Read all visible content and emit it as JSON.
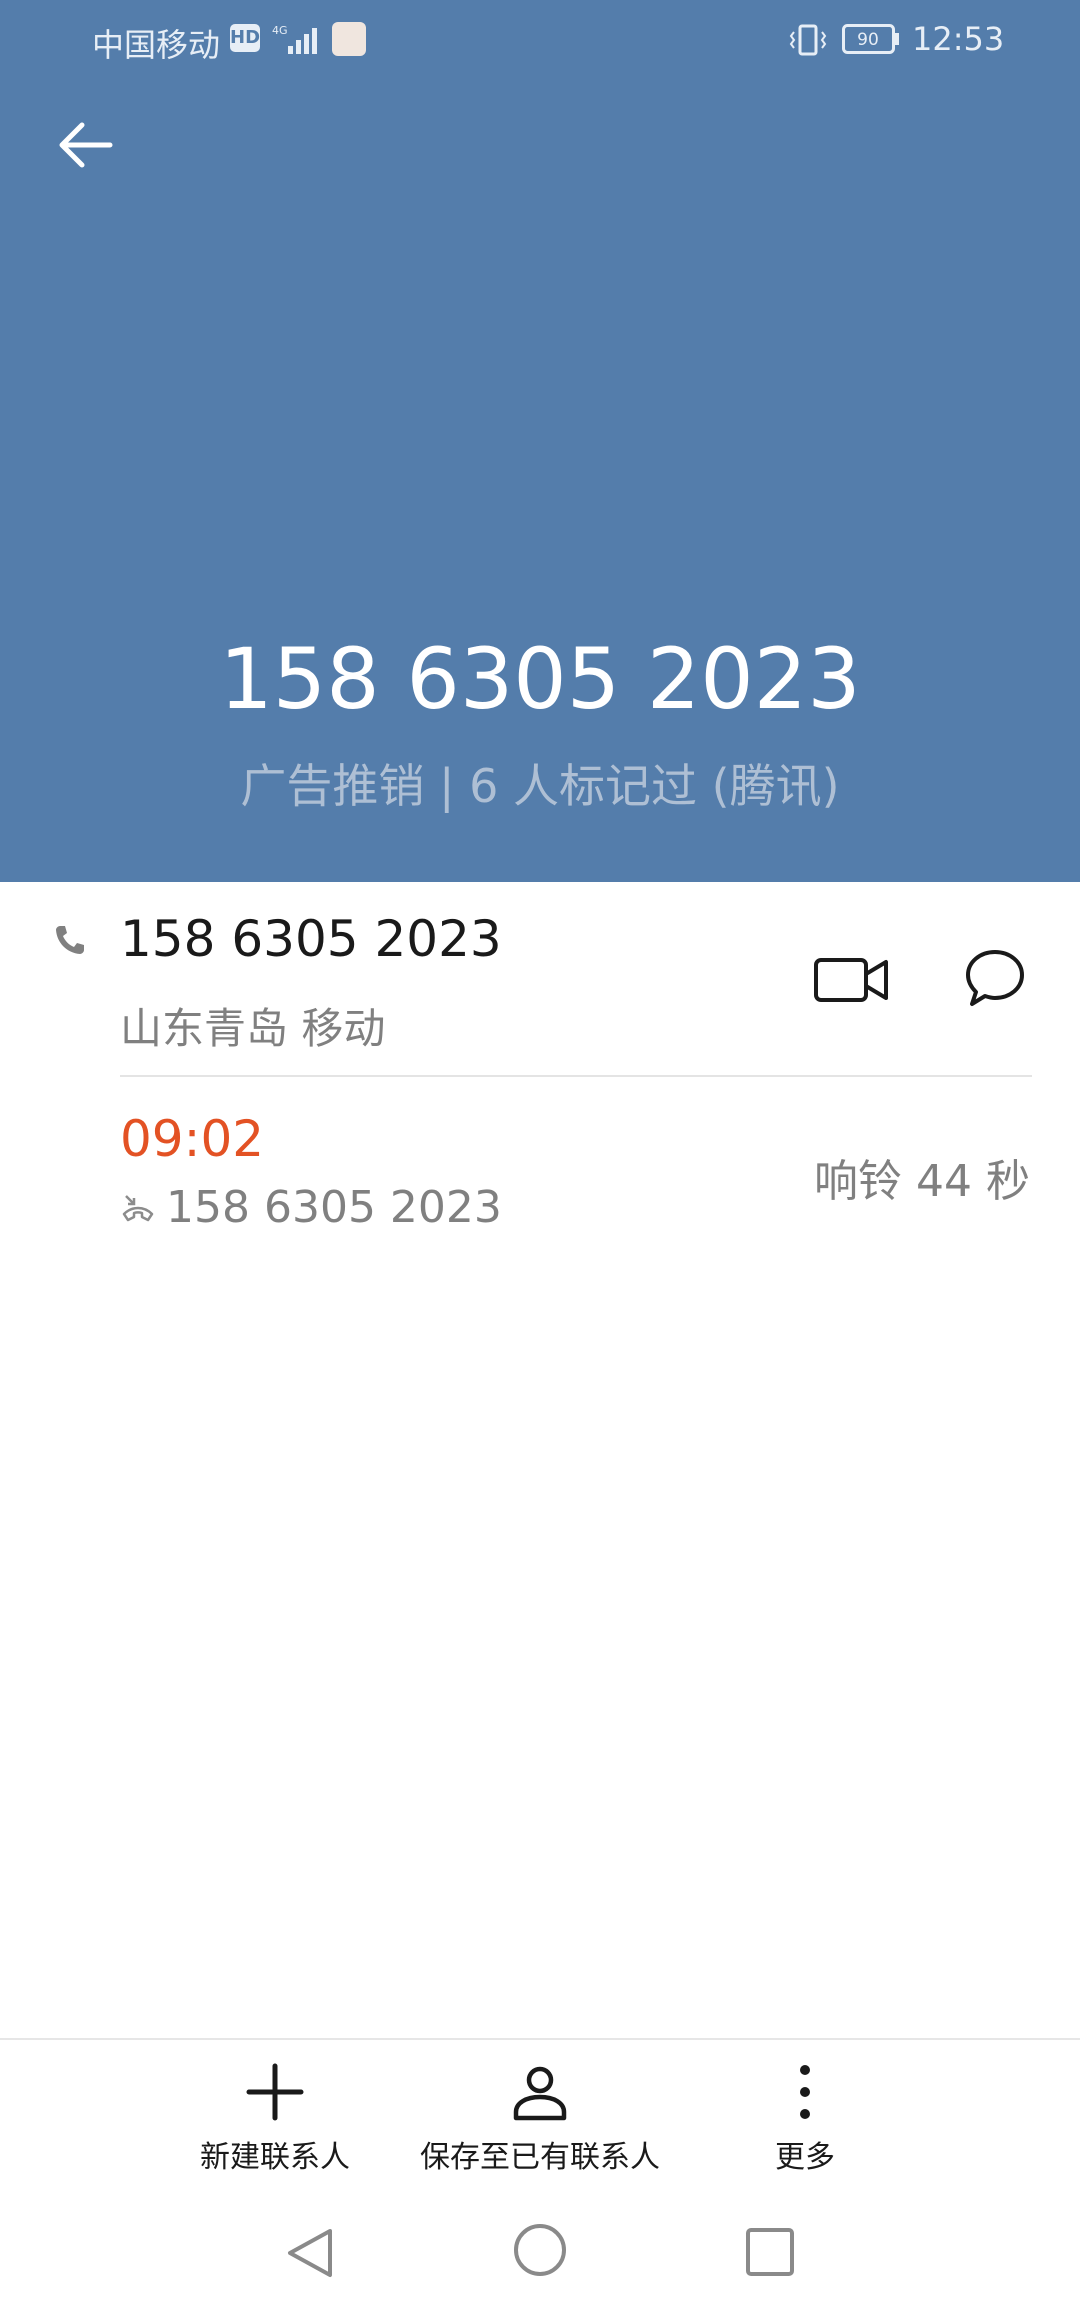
{
  "status_bar": {
    "carrier": "中国移动",
    "hd_badge": "HD",
    "battery": "90",
    "time": "12:53"
  },
  "header": {
    "number": "158 6305 2023",
    "tag": "广告推销 | 6 人标记过 (腾讯)",
    "background_color": "#547dab"
  },
  "contact": {
    "number": "158 6305 2023",
    "location": "山东青岛 移动"
  },
  "call_log": [
    {
      "time": "09:02",
      "number": "158 6305 2023",
      "duration": "响铃 44 秒",
      "time_color": "#e35224",
      "type_icon": "missed-call-icon"
    }
  ],
  "actions": {
    "new_contact": "新建联系人",
    "save_to_existing": "保存至已有联系人",
    "more": "更多"
  },
  "icons": {
    "back": "arrow-left-icon",
    "video": "video-call-icon",
    "message": "message-icon",
    "add": "plus-icon",
    "person": "person-icon",
    "more": "more-vertical-icon"
  }
}
